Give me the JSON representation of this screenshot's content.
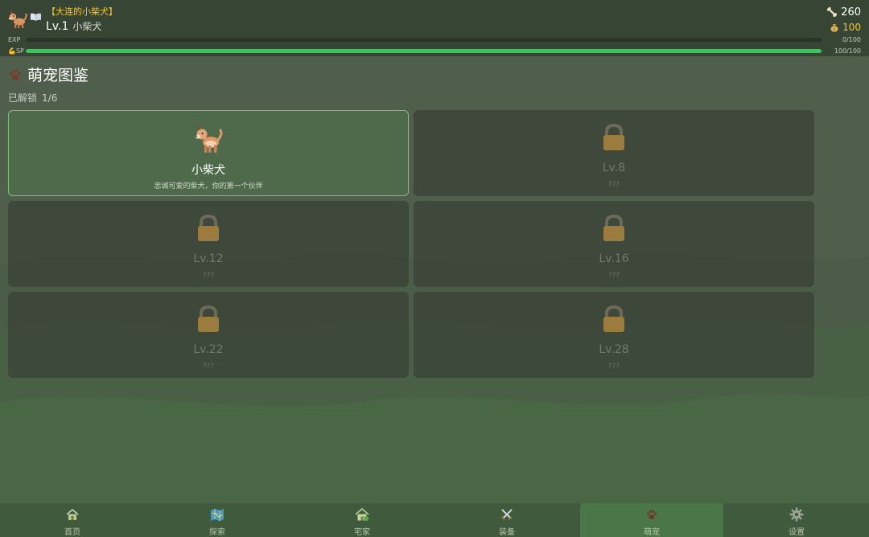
{
  "header": {
    "player_title": "【大连的小柴犬】",
    "level": "Lv.1",
    "pet_name": "小柴犬",
    "bones": "260",
    "coins": "100",
    "exp": {
      "label": "EXP",
      "value_text": "0/100",
      "fraction": 0.0
    },
    "sp": {
      "label": "SP",
      "value_text": "100/100",
      "fraction": 1.0
    }
  },
  "section": {
    "title": "萌宠图鉴",
    "unlocked_label": "已解锁",
    "unlocked_count": "1/6"
  },
  "pets": [
    {
      "name": "小柴犬",
      "desc": "忠诚可爱的柴犬，你的第一个伙伴",
      "unlocked": true
    },
    {
      "name": "Lv.8",
      "desc": "???",
      "unlocked": false
    },
    {
      "name": "Lv.12",
      "desc": "???",
      "unlocked": false
    },
    {
      "name": "Lv.16",
      "desc": "???",
      "unlocked": false
    },
    {
      "name": "Lv.22",
      "desc": "???",
      "unlocked": false
    },
    {
      "name": "Lv.28",
      "desc": "???",
      "unlocked": false
    }
  ],
  "nav": [
    {
      "label": "首页",
      "icon": "home-icon"
    },
    {
      "label": "探索",
      "icon": "map-icon"
    },
    {
      "label": "宅家",
      "icon": "house-icon"
    },
    {
      "label": "装备",
      "icon": "crossed-swords-icon"
    },
    {
      "label": "萌宠",
      "icon": "paw-icon",
      "active": true
    },
    {
      "label": "设置",
      "icon": "gear-icon"
    }
  ],
  "colors": {
    "accent_green": "#2ecc59",
    "gold": "#f2c63a",
    "active_tab": "#4b7648"
  }
}
